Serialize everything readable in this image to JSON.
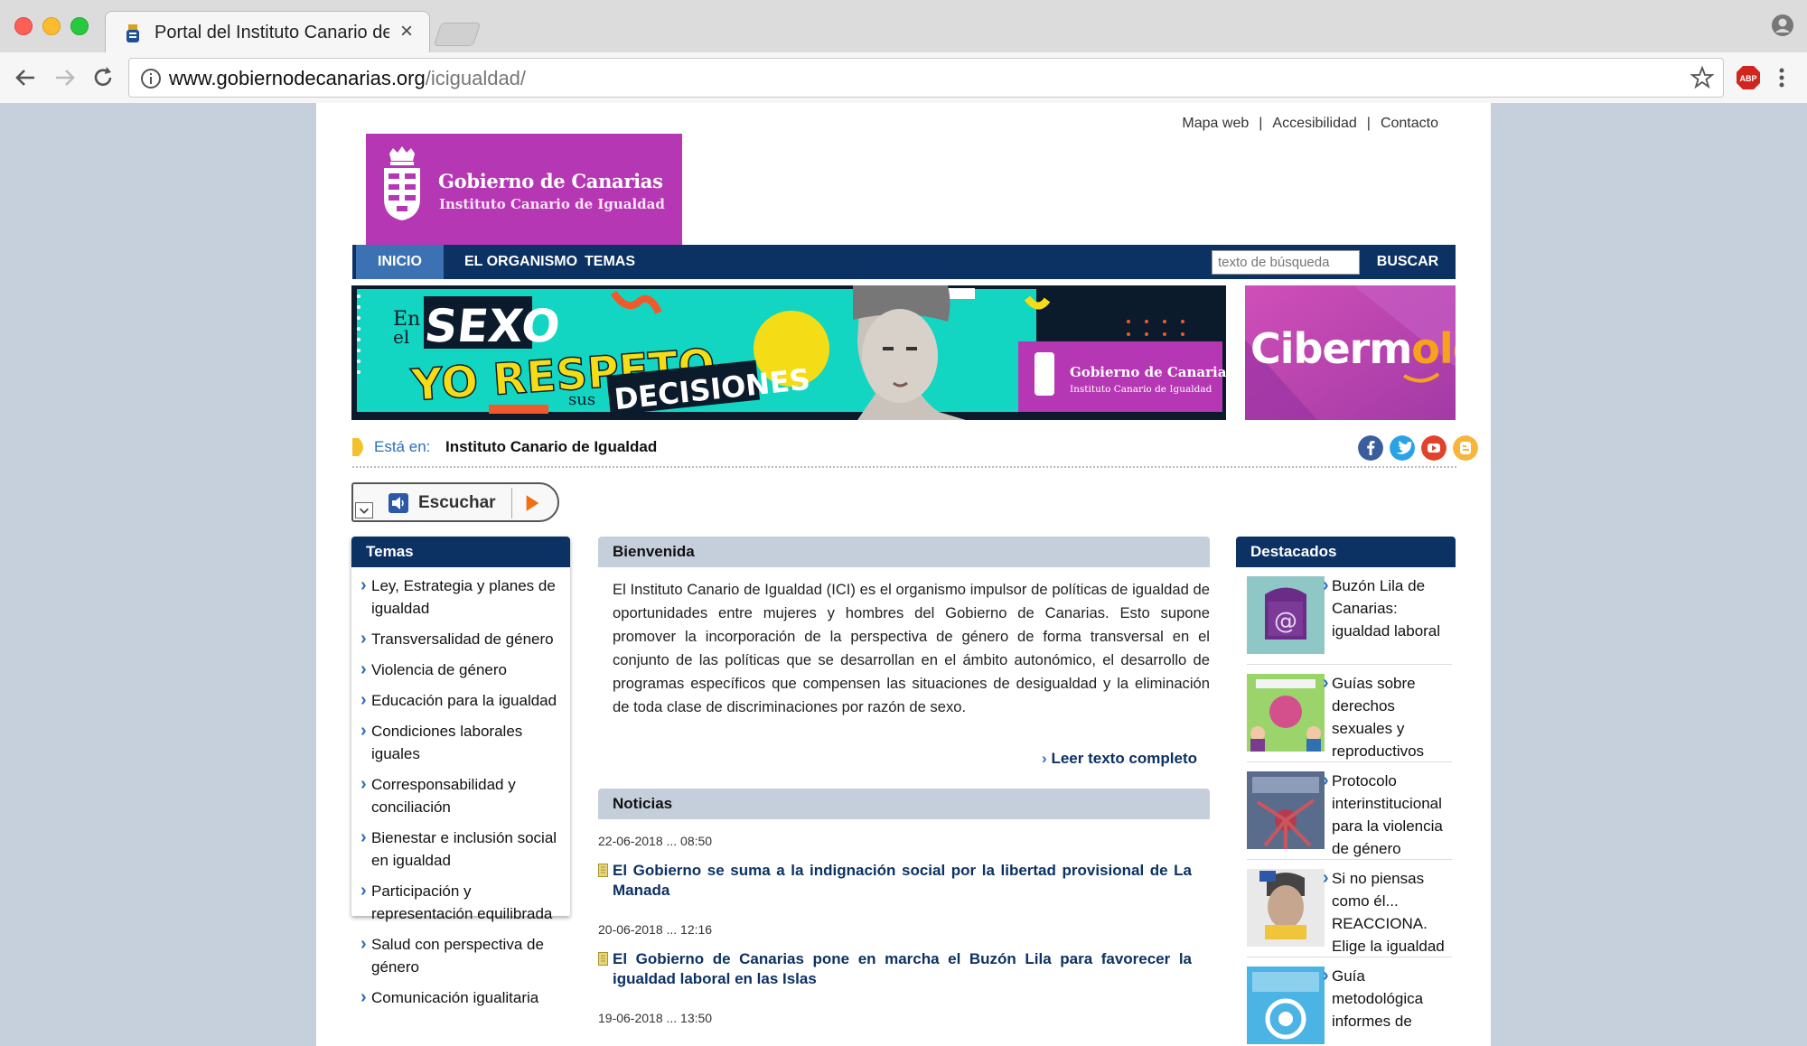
{
  "browser": {
    "tab_title": "Portal del Instituto Canario de Igualdad",
    "tab_close": "×",
    "url_domain": "www.gobiernodecanarias.org",
    "url_path": "/icigualdad/",
    "extension_label": "ABP"
  },
  "toplinks": {
    "map": "Mapa web",
    "accessibility": "Accesibilidad",
    "contact": "Contacto",
    "separator": "|"
  },
  "logo": {
    "title": "Gobierno de Canarias",
    "subtitle": "Instituto Canario de Igualdad"
  },
  "nav": {
    "items": [
      "INICIO",
      "EL ORGANISMO",
      "TEMAS"
    ],
    "search_placeholder": "texto de búsqueda",
    "search_button": "BUSCAR"
  },
  "banner": {
    "l1": "En",
    "l2": "SEXO",
    "l3": "el",
    "l4": "YO RESPETO",
    "l5": "sus",
    "l6": "DECISIONES",
    "logo_title": "Gobierno de Canarias",
    "logo_subtitle": "Instituto Canario de Igualdad"
  },
  "cibermolo": {
    "a": "Ciberm",
    "b": "olo"
  },
  "breadcrumb": {
    "label": "Está en:",
    "value": "Instituto Canario de Igualdad"
  },
  "social": [
    "facebook",
    "twitter",
    "youtube",
    "blogger"
  ],
  "escuchar": {
    "label": "Escuchar"
  },
  "temas": {
    "title": "Temas",
    "items": [
      "Ley, Estrategia y planes de igualdad",
      "Transversalidad de género",
      "Violencia de género",
      "Educación para la igualdad",
      "Condiciones laborales iguales",
      "Corresponsabilidad y conciliación",
      "Bienestar e inclusión social en igualdad",
      "Participación y representación equilibrada",
      "Salud con perspectiva de género",
      "Comunicación igualitaria"
    ]
  },
  "bienvenida": {
    "title": "Bienvenida",
    "text": "El Instituto Canario de Igualdad (ICI) es el organismo impulsor de políticas de igualdad de oportunidades entre mujeres y hombres del Gobierno de Canarias. Esto supone promover la incorporación de la perspectiva de género de forma transversal en el conjunto de las políticas que se desarrollan en el ámbito autonómico, el desarrollo de programas específicos que compensen las situaciones de desigualdad y la eliminación de toda clase de discriminaciones por razón de sexo.",
    "readmore": "Leer texto completo",
    "readmore_arrow": "›"
  },
  "noticias": {
    "title": "Noticias",
    "items": [
      {
        "date": "22-06-2018 ... 08:50",
        "title": "El Gobierno se suma a la indignación social por la libertad provisional de La Manada"
      },
      {
        "date": "20-06-2018 ... 12:16",
        "title": "El Gobierno de Canarias pone en marcha el Buzón Lila para favorecer la igualdad laboral en las Islas"
      },
      {
        "date": "19-06-2018 ... 13:50",
        "title": ""
      }
    ]
  },
  "destacados": {
    "title": "Destacados",
    "items": [
      "Buzón Lila de Canarias: igualdad laboral",
      "Guías sobre derechos sexuales y reproductivos",
      "Protocolo interinstitucional para la violencia de género",
      "Si no piensas como él... REACCIONA. Elige la igualdad",
      "Guía metodológica informes de"
    ]
  },
  "colors": {
    "navy": "#0c3163",
    "active": "#3c72b4",
    "logo_bg": "#b637b3",
    "link": "#2a6fbe",
    "head_gray": "#c5cfdb"
  }
}
